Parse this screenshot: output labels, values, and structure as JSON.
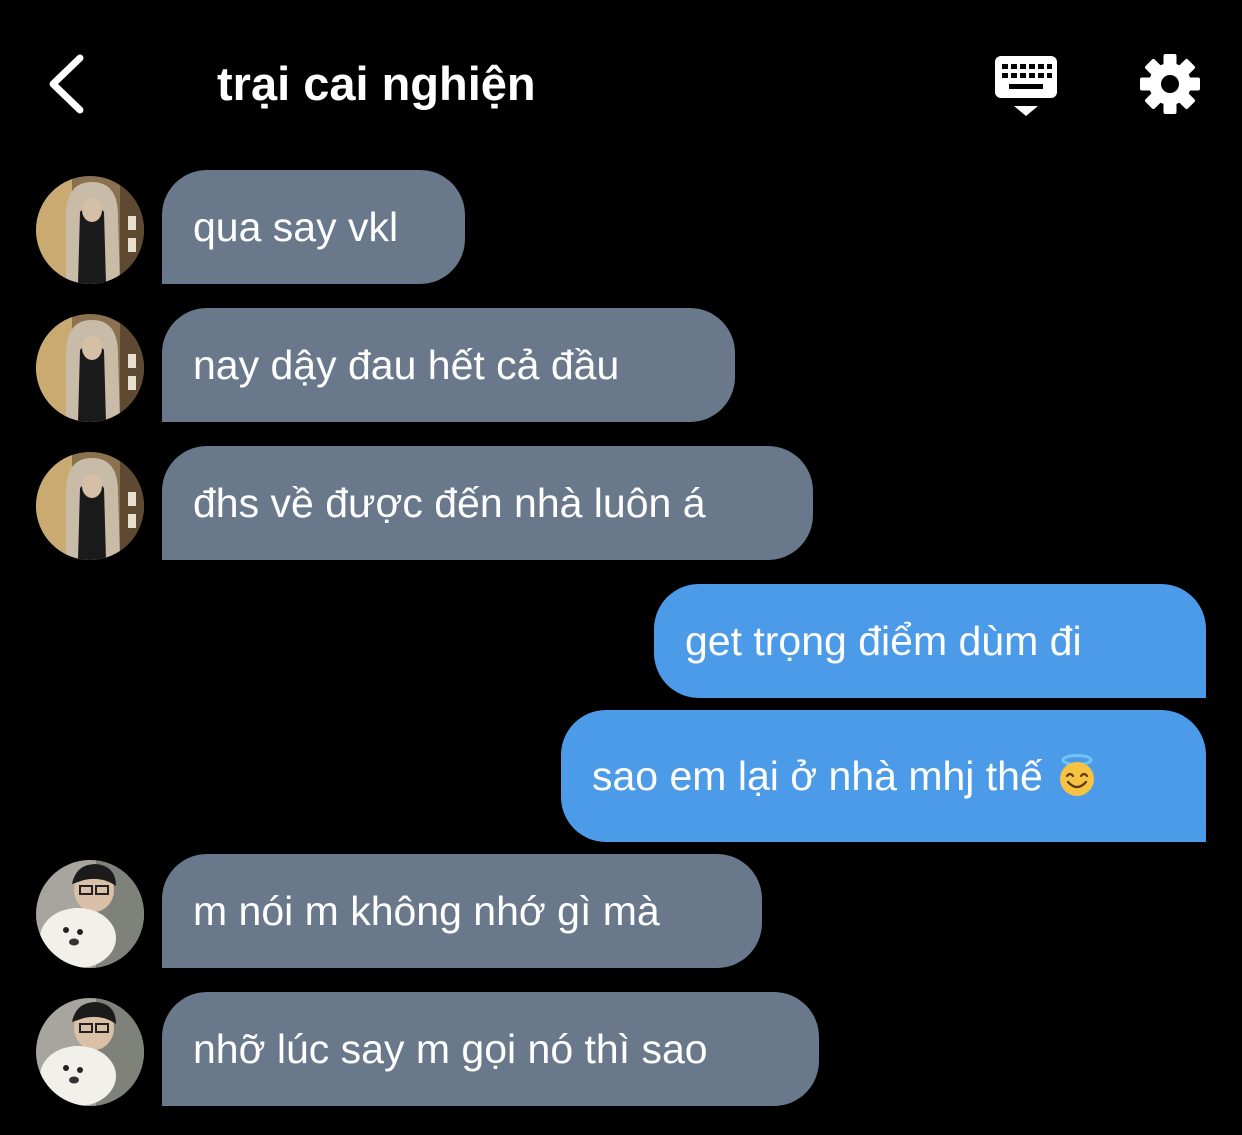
{
  "header": {
    "title": "trại cai nghiện",
    "back_icon": "chevron-left-icon",
    "keyboard_icon": "keyboard-icon",
    "settings_icon": "gear-icon"
  },
  "colors": {
    "background": "#000000",
    "incoming_bubble": "#69788a",
    "outgoing_bubble": "#4c9be8",
    "text": "#ffffff"
  },
  "messages": [
    {
      "sender": "other",
      "avatar": "hooded-person-avatar",
      "text": "qua say vkl"
    },
    {
      "sender": "other",
      "avatar": "hooded-person-avatar",
      "text": "nay dậy đau hết cả đầu"
    },
    {
      "sender": "other",
      "avatar": "hooded-person-avatar",
      "text": "đhs về được đến nhà luôn á"
    },
    {
      "sender": "me",
      "text": "get trọng điểm dùm đi"
    },
    {
      "sender": "me",
      "text": "sao em lại ở nhà mhj thế",
      "emoji": "smiling-face-with-halo"
    },
    {
      "sender": "other",
      "avatar": "boy-with-dog-avatar",
      "text": "m nói m không nhớ gì mà"
    },
    {
      "sender": "other",
      "avatar": "boy-with-dog-avatar",
      "text": "nhỡ lúc say m gọi nó thì sao"
    }
  ]
}
